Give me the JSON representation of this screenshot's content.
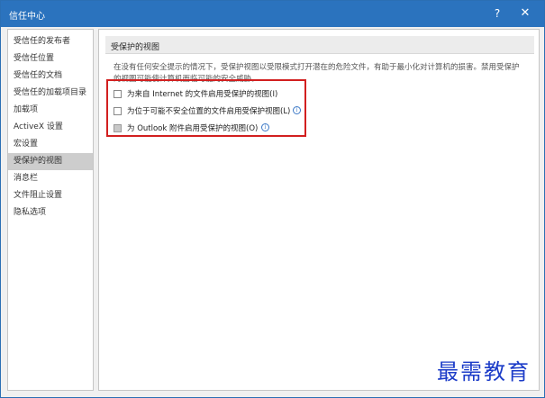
{
  "window": {
    "title": "信任中心",
    "help_label": "?",
    "close_label": "✕"
  },
  "sidebar": {
    "items": [
      {
        "label": "受信任的发布者"
      },
      {
        "label": "受信任位置"
      },
      {
        "label": "受信任的文档"
      },
      {
        "label": "受信任的加载项目录"
      },
      {
        "label": "加载项"
      },
      {
        "label": "ActiveX 设置"
      },
      {
        "label": "宏设置"
      },
      {
        "label": "受保护的视图"
      },
      {
        "label": "消息栏"
      },
      {
        "label": "文件阻止设置"
      },
      {
        "label": "隐私选项"
      }
    ],
    "selected_index": 7
  },
  "main": {
    "section_title": "受保护的视图",
    "description_line1": "在没有任何安全提示的情况下，受保护视图以受限模式打开潜在的危险文件，有助于最小化对计算机的损害。禁用受保护",
    "description_line2": "的视图可能使计算机面临可能的安全威胁。",
    "options": [
      {
        "label": "为来自 Internet 的文件启用受保护的视图(I)",
        "checked": false,
        "enabled": true,
        "info": false
      },
      {
        "label": "为位于可能不安全位置的文件启用受保护视图(L)",
        "checked": false,
        "enabled": true,
        "info": true
      },
      {
        "label": "为 Outlook 附件启用受保护的视图(O)",
        "checked": false,
        "enabled": false,
        "info": true
      }
    ],
    "info_glyph": "i"
  },
  "watermark": {
    "text": "最需教育"
  },
  "colors": {
    "titlebar": "#2b73be",
    "highlight_border": "#d21f1f",
    "watermark": "#1c3cc8",
    "selected_item": "#cdcdcd"
  }
}
